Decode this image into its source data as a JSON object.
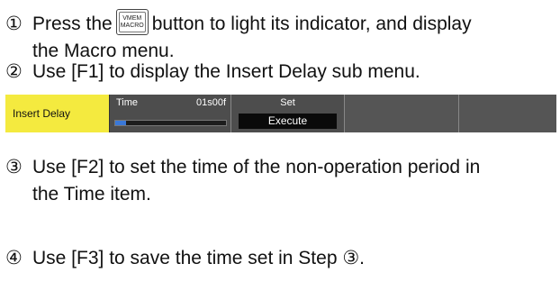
{
  "steps": [
    {
      "num": "①",
      "line1_before": "Press the",
      "line1_after": "button to light its indicator, and display",
      "line2": "the Macro menu."
    },
    {
      "num": "②",
      "line1": "Use [F1] to display the Insert Delay sub menu."
    },
    {
      "num": "③",
      "line1": "Use [F2] to set the time of the non-operation period in",
      "line2": "the Time item."
    },
    {
      "num": "④",
      "line1": "Use [F3] to save the time set in Step ③."
    }
  ],
  "button_icon": {
    "name": "vmem-macro-button",
    "line1": "VMEM",
    "line2": "MACRO"
  },
  "menu": {
    "title": "Insert Delay",
    "time_label": "Time",
    "time_value": "01s00f",
    "time_progress": 0.1,
    "set_label": "Set",
    "set_button": "Execute"
  },
  "colors": {
    "menu_title_bg": "#f4ea3f",
    "menu_bg": "#555555",
    "progress_fill": "#3a78d8",
    "execute_bg": "#0a0a0a"
  }
}
